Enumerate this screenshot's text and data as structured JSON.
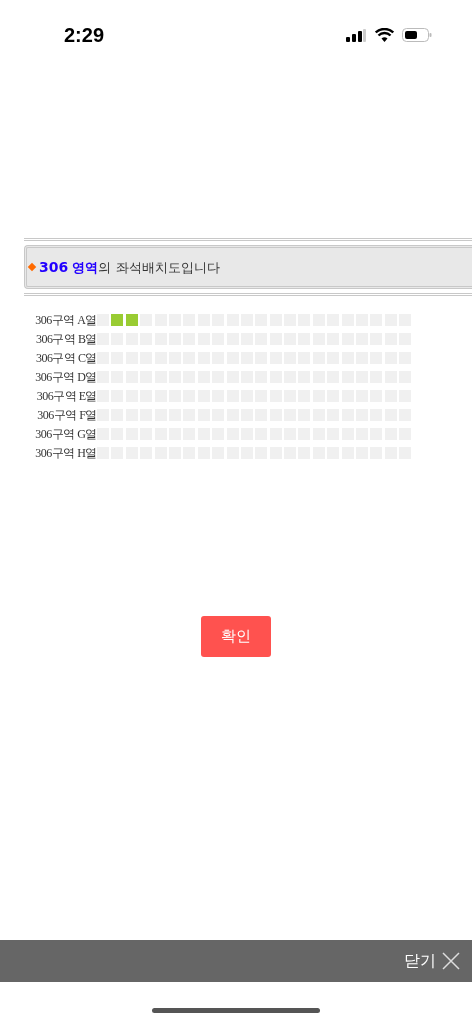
{
  "status_bar": {
    "time": "2:29"
  },
  "header": {
    "title_bold": "306",
    "title_area": "영역",
    "title_rest": "의 좌석배치도입니다"
  },
  "rows": [
    {
      "label": "306구역 A열",
      "seats": [
        {
          "available": false
        },
        {
          "available": true
        },
        {
          "available": true
        },
        {
          "available": false
        },
        {
          "available": false
        },
        {
          "available": false
        },
        {
          "available": false
        },
        {
          "available": false
        },
        {
          "available": false
        },
        {
          "available": false
        },
        {
          "available": false
        },
        {
          "available": false
        },
        {
          "available": false
        },
        {
          "available": false
        },
        {
          "available": false
        },
        {
          "available": false
        },
        {
          "available": false
        },
        {
          "available": false
        },
        {
          "available": false
        },
        {
          "available": false
        },
        {
          "available": false
        },
        {
          "available": false
        }
      ]
    },
    {
      "label": "306구역 B열",
      "seats": [
        {
          "available": false
        },
        {
          "available": false
        },
        {
          "available": false
        },
        {
          "available": false
        },
        {
          "available": false
        },
        {
          "available": false
        },
        {
          "available": false
        },
        {
          "available": false
        },
        {
          "available": false
        },
        {
          "available": false
        },
        {
          "available": false
        },
        {
          "available": false
        },
        {
          "available": false
        },
        {
          "available": false
        },
        {
          "available": false
        },
        {
          "available": false
        },
        {
          "available": false
        },
        {
          "available": false
        },
        {
          "available": false
        },
        {
          "available": false
        },
        {
          "available": false
        },
        {
          "available": false
        }
      ]
    },
    {
      "label": "306구역 C열",
      "seats": [
        {
          "available": false
        },
        {
          "available": false
        },
        {
          "available": false
        },
        {
          "available": false
        },
        {
          "available": false
        },
        {
          "available": false
        },
        {
          "available": false
        },
        {
          "available": false
        },
        {
          "available": false
        },
        {
          "available": false
        },
        {
          "available": false
        },
        {
          "available": false
        },
        {
          "available": false
        },
        {
          "available": false
        },
        {
          "available": false
        },
        {
          "available": false
        },
        {
          "available": false
        },
        {
          "available": false
        },
        {
          "available": false
        },
        {
          "available": false
        },
        {
          "available": false
        },
        {
          "available": false
        }
      ]
    },
    {
      "label": "306구역 D열",
      "seats": [
        {
          "available": false
        },
        {
          "available": false
        },
        {
          "available": false
        },
        {
          "available": false
        },
        {
          "available": false
        },
        {
          "available": false
        },
        {
          "available": false
        },
        {
          "available": false
        },
        {
          "available": false
        },
        {
          "available": false
        },
        {
          "available": false
        },
        {
          "available": false
        },
        {
          "available": false
        },
        {
          "available": false
        },
        {
          "available": false
        },
        {
          "available": false
        },
        {
          "available": false
        },
        {
          "available": false
        },
        {
          "available": false
        },
        {
          "available": false
        },
        {
          "available": false
        },
        {
          "available": false
        }
      ]
    },
    {
      "label": "306구역 E열",
      "seats": [
        {
          "available": false
        },
        {
          "available": false
        },
        {
          "available": false
        },
        {
          "available": false
        },
        {
          "available": false
        },
        {
          "available": false
        },
        {
          "available": false
        },
        {
          "available": false
        },
        {
          "available": false
        },
        {
          "available": false
        },
        {
          "available": false
        },
        {
          "available": false
        },
        {
          "available": false
        },
        {
          "available": false
        },
        {
          "available": false
        },
        {
          "available": false
        },
        {
          "available": false
        },
        {
          "available": false
        },
        {
          "available": false
        },
        {
          "available": false
        },
        {
          "available": false
        },
        {
          "available": false
        }
      ]
    },
    {
      "label": "306구역 F열",
      "seats": [
        {
          "available": false
        },
        {
          "available": false
        },
        {
          "available": false
        },
        {
          "available": false
        },
        {
          "available": false
        },
        {
          "available": false
        },
        {
          "available": false
        },
        {
          "available": false
        },
        {
          "available": false
        },
        {
          "available": false
        },
        {
          "available": false
        },
        {
          "available": false
        },
        {
          "available": false
        },
        {
          "available": false
        },
        {
          "available": false
        },
        {
          "available": false
        },
        {
          "available": false
        },
        {
          "available": false
        },
        {
          "available": false
        },
        {
          "available": false
        },
        {
          "available": false
        },
        {
          "available": false
        }
      ]
    },
    {
      "label": "306구역 G열",
      "seats": [
        {
          "available": false
        },
        {
          "available": false
        },
        {
          "available": false
        },
        {
          "available": false
        },
        {
          "available": false
        },
        {
          "available": false
        },
        {
          "available": false
        },
        {
          "available": false
        },
        {
          "available": false
        },
        {
          "available": false
        },
        {
          "available": false
        },
        {
          "available": false
        },
        {
          "available": false
        },
        {
          "available": false
        },
        {
          "available": false
        },
        {
          "available": false
        },
        {
          "available": false
        },
        {
          "available": false
        },
        {
          "available": false
        },
        {
          "available": false
        },
        {
          "available": false
        },
        {
          "available": false
        }
      ]
    },
    {
      "label": "306구역 H열",
      "seats": [
        {
          "available": false
        },
        {
          "available": false
        },
        {
          "available": false
        },
        {
          "available": false
        },
        {
          "available": false
        },
        {
          "available": false
        },
        {
          "available": false
        },
        {
          "available": false
        },
        {
          "available": false
        },
        {
          "available": false
        },
        {
          "available": false
        },
        {
          "available": false
        },
        {
          "available": false
        },
        {
          "available": false
        },
        {
          "available": false
        },
        {
          "available": false
        },
        {
          "available": false
        },
        {
          "available": false
        },
        {
          "available": false
        },
        {
          "available": false
        },
        {
          "available": false
        },
        {
          "available": false
        }
      ]
    }
  ],
  "confirm_button": "확인",
  "close_bar": {
    "label": "닫기"
  }
}
